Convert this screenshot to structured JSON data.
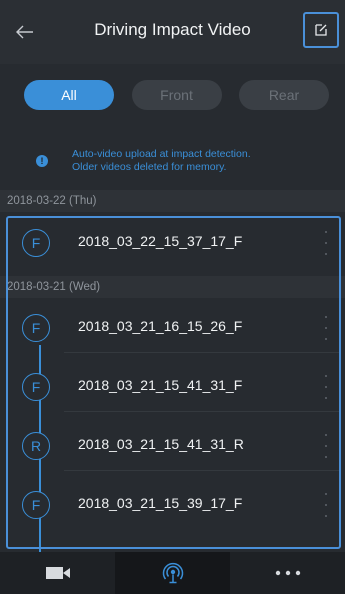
{
  "header": {
    "title": "Driving Impact Video"
  },
  "filters": [
    {
      "label": "All",
      "active": true
    },
    {
      "label": "Front",
      "active": false
    },
    {
      "label": "Rear",
      "active": false
    }
  ],
  "notice": {
    "line1": "Auto-video upload at impact detection.",
    "line2": "Older videos deleted for memory."
  },
  "groups": [
    {
      "date": "2018-03-22 (Thu)",
      "items": [
        {
          "badge": "F",
          "name": "2018_03_22_15_37_17_F"
        }
      ]
    },
    {
      "date": "2018-03-21 (Wed)",
      "items": [
        {
          "badge": "F",
          "name": "2018_03_21_16_15_26_F"
        },
        {
          "badge": "F",
          "name": "2018_03_21_15_41_31_F"
        },
        {
          "badge": "R",
          "name": "2018_03_21_15_41_31_R"
        },
        {
          "badge": "F",
          "name": "2018_03_21_15_39_17_F"
        }
      ]
    }
  ],
  "bottom_nav": [
    {
      "icon": "video-camera-icon",
      "active": false
    },
    {
      "icon": "impact-upload-icon",
      "active": true
    },
    {
      "icon": "more-icon",
      "active": false
    }
  ],
  "colors": {
    "accent": "#3a8fd8",
    "background": "#272b30",
    "highlight": "#4a90d9"
  }
}
